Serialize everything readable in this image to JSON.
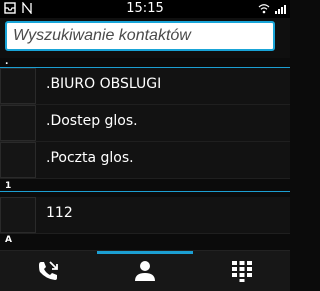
{
  "status_bar": {
    "time": "15:15",
    "icons": [
      "notification-box-icon",
      "nfc-n-icon",
      "wifi-icon",
      "signal-bars-icon"
    ]
  },
  "search": {
    "placeholder": "Wyszukiwanie kontaktów"
  },
  "sections": [
    {
      "label": "."
    },
    {
      "label": "1"
    },
    {
      "label": "A"
    }
  ],
  "contacts": [
    {
      "name": ".BIURO OBSLUGI"
    },
    {
      "name": ".Dostep glos."
    },
    {
      "name": ".Poczta glos."
    },
    {
      "name": "112"
    }
  ],
  "bottom_tabs": [
    {
      "icon": "call-log-icon",
      "active": false
    },
    {
      "icon": "contacts-person-icon",
      "active": true
    },
    {
      "icon": "dialpad-icon",
      "active": false
    }
  ],
  "colors": {
    "accent": "#1c9fd2",
    "background": "#0b0b0b"
  }
}
